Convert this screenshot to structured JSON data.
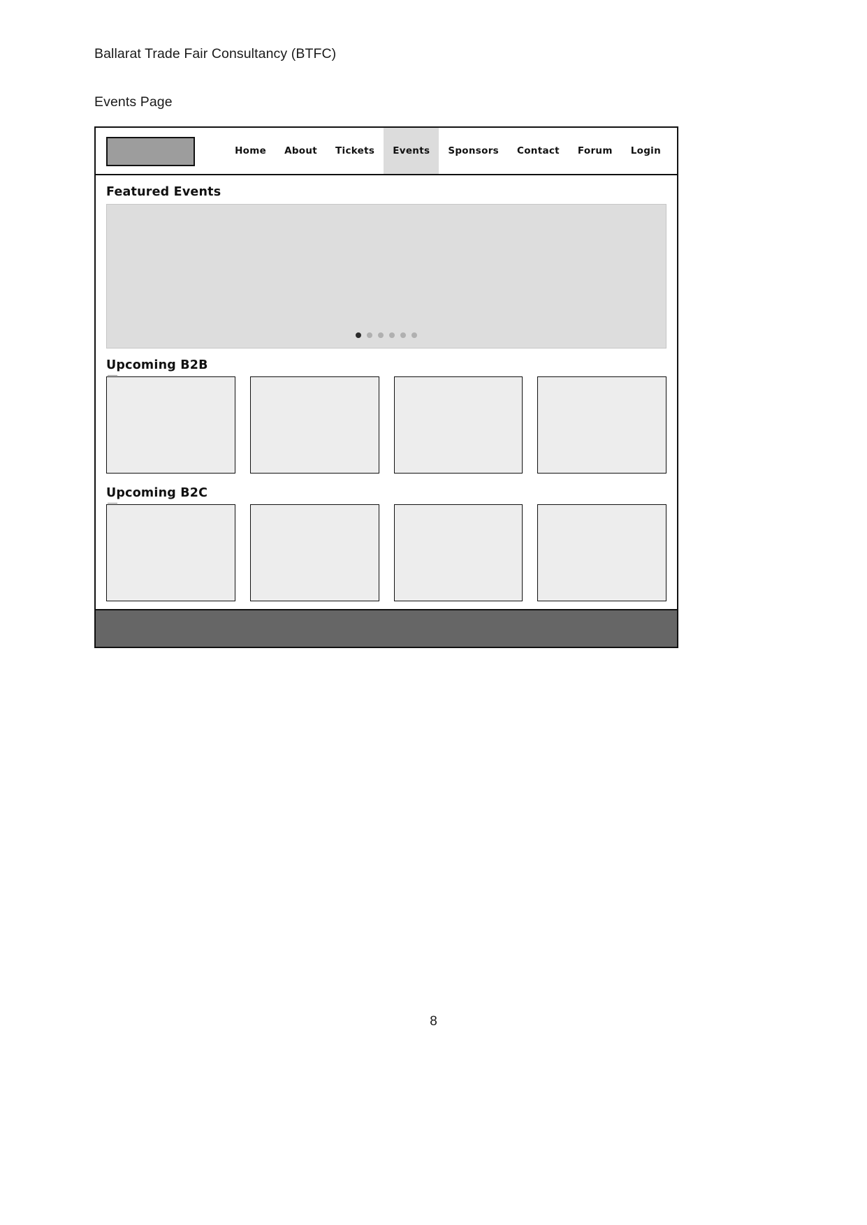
{
  "document": {
    "title": "Ballarat Trade Fair Consultancy (BTFC)",
    "subtitle": "Events Page",
    "page_number": "8"
  },
  "wireframe": {
    "navbar": {
      "logo_placeholder": "",
      "items": [
        {
          "label": "Home",
          "active": false
        },
        {
          "label": "About",
          "active": false
        },
        {
          "label": "Tickets",
          "active": false
        },
        {
          "label": "Events",
          "active": true
        },
        {
          "label": "Sponsors",
          "active": false
        },
        {
          "label": "Contact",
          "active": false
        },
        {
          "label": "Forum",
          "active": false
        },
        {
          "label": "Login",
          "active": false
        }
      ]
    },
    "sections": [
      {
        "heading": "Featured Events",
        "type": "carousel",
        "dots": 6,
        "active_dot": 0
      },
      {
        "heading": "Upcoming B2B",
        "type": "cards",
        "card_count": 4
      },
      {
        "heading": "Upcoming B2C",
        "type": "cards",
        "card_count": 4
      }
    ],
    "footer": {
      "label": ""
    }
  },
  "colors": {
    "logo_fill": "#9d9d9d",
    "active_nav_bg": "#dcdcdc",
    "carousel_fill": "#dddddd",
    "card_fill": "#ededed",
    "footer_fill": "#666666",
    "dot_active": "#2b2b2b",
    "dot_inactive": "#b0b0b0",
    "outline": "#111111"
  }
}
